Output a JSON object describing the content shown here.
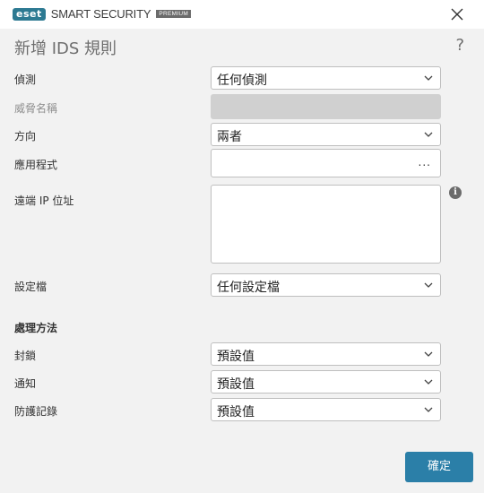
{
  "app": {
    "logo_text": "eset",
    "product": "SMART SECURITY",
    "edition": "PREMIUM"
  },
  "dialog": {
    "title": "新增 IDS 規則",
    "help_label": "?"
  },
  "fields": {
    "detection": {
      "label": "偵測",
      "value": "任何偵測"
    },
    "threat_name": {
      "label": "威脅名稱",
      "value": ""
    },
    "direction": {
      "label": "方向",
      "value": "兩者"
    },
    "application": {
      "label": "應用程式",
      "value": "",
      "browse_label": "..."
    },
    "remote_ip": {
      "label": "遠端 IP 位址",
      "value": ""
    },
    "profile": {
      "label": "設定檔",
      "value": "任何設定檔"
    }
  },
  "actions_section": {
    "title": "處理方法",
    "block": {
      "label": "封鎖",
      "value": "預設值"
    },
    "notify": {
      "label": "通知",
      "value": "預設值"
    },
    "log": {
      "label": "防護記錄",
      "value": "預設值"
    }
  },
  "buttons": {
    "ok_label": "確定"
  },
  "icons": {
    "close": "close-icon",
    "chevron": "chevron-down-icon",
    "info": "info-icon"
  },
  "colors": {
    "accent": "#2b7fa8",
    "logo": "#2d7a92",
    "background": "#f2f2f2"
  }
}
